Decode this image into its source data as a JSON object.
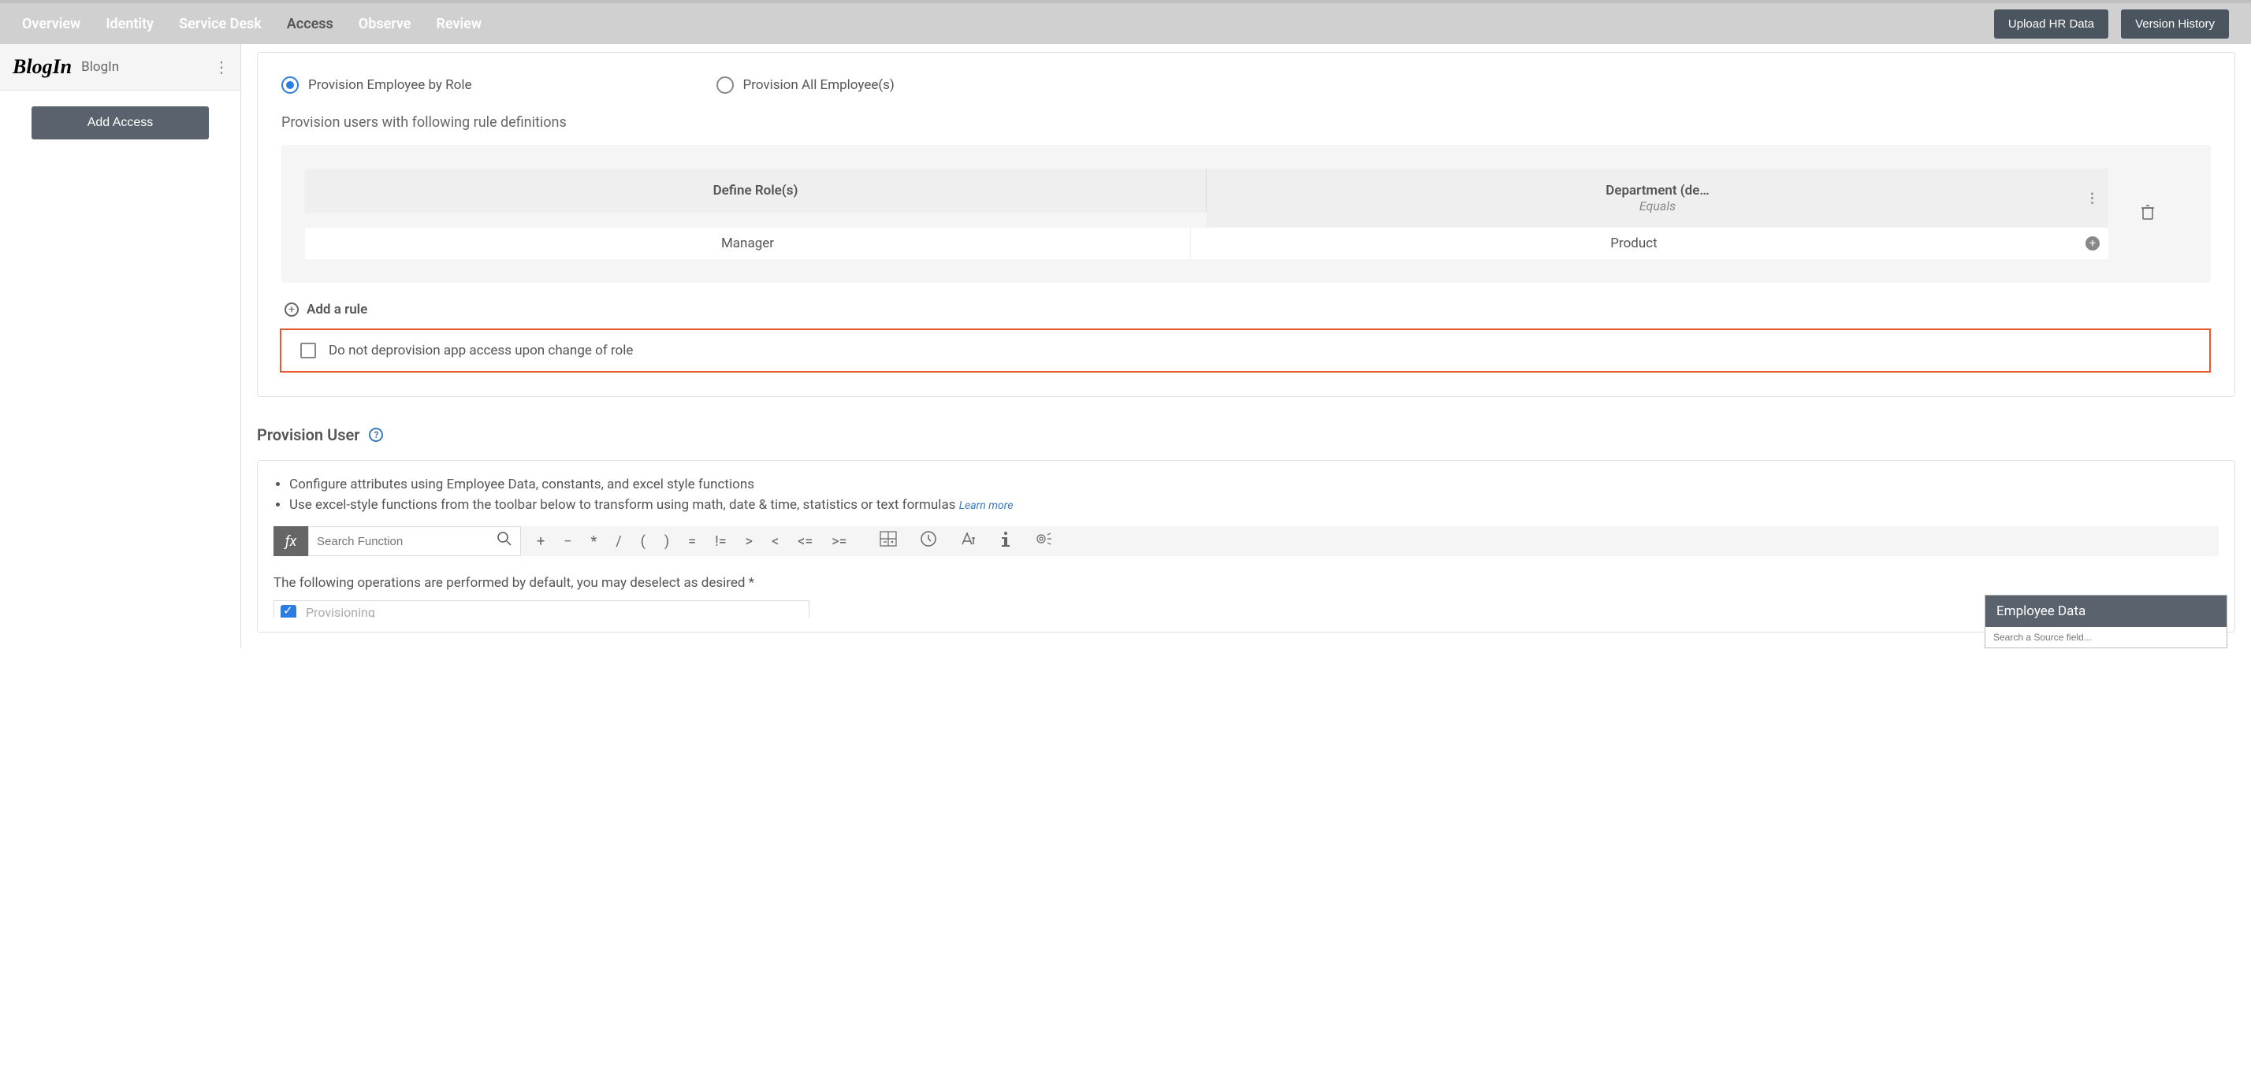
{
  "header": {
    "tabs": [
      "Overview",
      "Identity",
      "Service Desk",
      "Access",
      "Observe",
      "Review"
    ],
    "active_tab": "Access",
    "upload_btn": "Upload HR Data",
    "history_btn": "Version History"
  },
  "sidebar": {
    "logo_text": "BlogIn",
    "app_name": "BlogIn",
    "add_access_btn": "Add Access"
  },
  "provision": {
    "radio1": "Provision Employee by Role",
    "radio2": "Provision All Employee(s)",
    "rule_desc": "Provision users with following rule definitions",
    "col1_header": "Define Role(s)",
    "col2_header": "Department (de…",
    "col2_sub": "Equals",
    "col1_value": "Manager",
    "col2_value": "Product",
    "add_rule": "Add a rule",
    "checkbox_label": "Do not deprovision app access upon change of role"
  },
  "section": {
    "title": "Provision User",
    "bullet1": "Configure attributes using Employee Data, constants, and excel style functions",
    "bullet2": "Use excel-style functions from the toolbar below to transform using math, date & time, statistics or text formulas",
    "learn_more": "Learn more",
    "fx": "ƒx",
    "search_placeholder": "Search Function",
    "ops": [
      "+",
      "−",
      "*",
      "/",
      "(",
      ")",
      "=",
      "!=",
      ">",
      "<",
      "<=",
      ">="
    ],
    "default_ops": "The following operations are performed by default, you may deselect as desired *",
    "provisioning": "Provisioning"
  },
  "employee_panel": {
    "title": "Employee Data",
    "search_placeholder": "Search a Source field..."
  }
}
